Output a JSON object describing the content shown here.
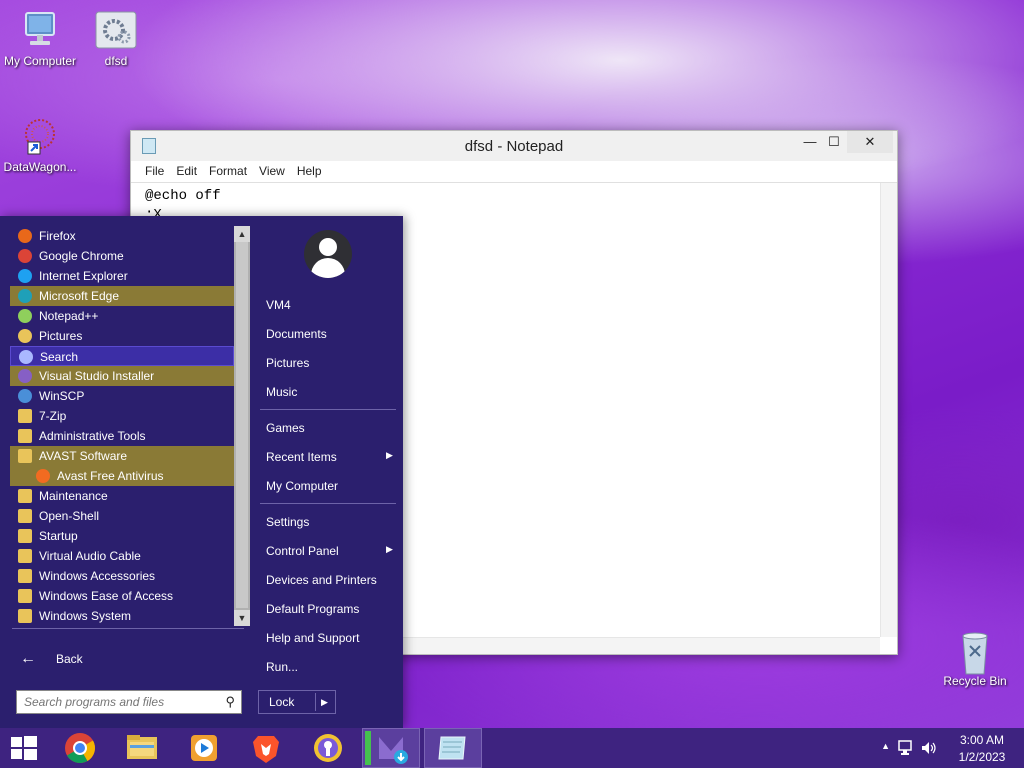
{
  "desktop": {
    "icons": [
      {
        "label": "My Computer"
      },
      {
        "label": "dfsd"
      },
      {
        "label": "DataWagon..."
      },
      {
        "label": "Recycle Bin"
      }
    ]
  },
  "notepad": {
    "title": "dfsd - Notepad",
    "menu": [
      "File",
      "Edit",
      "Format",
      "View",
      "Help"
    ],
    "content": "@echo off\n:X\nStart notepad\ngoto X",
    "buttons": {
      "minimize": "—",
      "maximize": "☐",
      "close": "✕"
    }
  },
  "startmenu": {
    "programs": [
      {
        "label": "Firefox",
        "icon": "firefox-icon",
        "color": "#e8681a"
      },
      {
        "label": "Google Chrome",
        "icon": "chrome-icon",
        "color": "#db4437"
      },
      {
        "label": "Internet Explorer",
        "icon": "ie-icon",
        "color": "#1ea1f1"
      },
      {
        "label": "Microsoft Edge",
        "icon": "edge-icon",
        "color": "#1fa0b8",
        "state": "highlight"
      },
      {
        "label": "Notepad++",
        "icon": "notepadpp-icon",
        "color": "#8fcf5c"
      },
      {
        "label": "Pictures",
        "icon": "pictures-icon",
        "color": "#e9c45a"
      },
      {
        "label": "Search",
        "icon": "search-icon",
        "color": "#aab8ff",
        "state": "selected"
      },
      {
        "label": "Visual Studio Installer",
        "icon": "vs-installer-icon",
        "color": "#865fc5",
        "state": "highlight"
      },
      {
        "label": "WinSCP",
        "icon": "winscp-icon",
        "color": "#4a8fd8"
      },
      {
        "label": "7-Zip",
        "icon": "folder-icon",
        "color": "#e9c45a"
      },
      {
        "label": "Administrative Tools",
        "icon": "folder-icon",
        "color": "#e9c45a"
      },
      {
        "label": "AVAST Software",
        "icon": "folder-icon",
        "color": "#e9c45a",
        "state": "highlight"
      },
      {
        "label": "Avast Free Antivirus",
        "icon": "avast-icon",
        "color": "#f26b21",
        "state": "highlight",
        "sub": true
      },
      {
        "label": "Maintenance",
        "icon": "folder-icon",
        "color": "#e9c45a"
      },
      {
        "label": "Open-Shell",
        "icon": "folder-icon",
        "color": "#e9c45a"
      },
      {
        "label": "Startup",
        "icon": "folder-icon",
        "color": "#e9c45a"
      },
      {
        "label": "Virtual Audio Cable",
        "icon": "folder-icon",
        "color": "#e9c45a"
      },
      {
        "label": "Windows Accessories",
        "icon": "folder-icon",
        "color": "#e9c45a"
      },
      {
        "label": "Windows Ease of Access",
        "icon": "folder-icon",
        "color": "#e9c45a"
      },
      {
        "label": "Windows System",
        "icon": "folder-icon",
        "color": "#e9c45a"
      }
    ],
    "back_label": "Back",
    "search_placeholder": "Search programs and files",
    "right": {
      "items": [
        {
          "label": "VM4"
        },
        {
          "label": "Documents"
        },
        {
          "label": "Pictures"
        },
        {
          "label": "Music"
        },
        {
          "label": "Games"
        },
        {
          "label": "Recent Items",
          "submenu": true
        },
        {
          "label": "My Computer"
        },
        {
          "label": "Settings"
        },
        {
          "label": "Control Panel",
          "submenu": true
        },
        {
          "label": "Devices and Printers"
        },
        {
          "label": "Default Programs"
        },
        {
          "label": "Help and Support"
        },
        {
          "label": "Run..."
        }
      ],
      "lock_label": "Lock"
    }
  },
  "taskbar": {
    "apps": [
      {
        "icon": "start-icon"
      },
      {
        "icon": "chrome-icon"
      },
      {
        "icon": "file-explorer-icon"
      },
      {
        "icon": "media-player-icon"
      },
      {
        "icon": "brave-icon"
      },
      {
        "icon": "keepass-icon"
      },
      {
        "icon": "installer-icon",
        "active": true
      },
      {
        "icon": "notepad-icon",
        "active": true
      }
    ],
    "clock": {
      "time": "3:00 AM",
      "date": "1/2/2023"
    }
  }
}
